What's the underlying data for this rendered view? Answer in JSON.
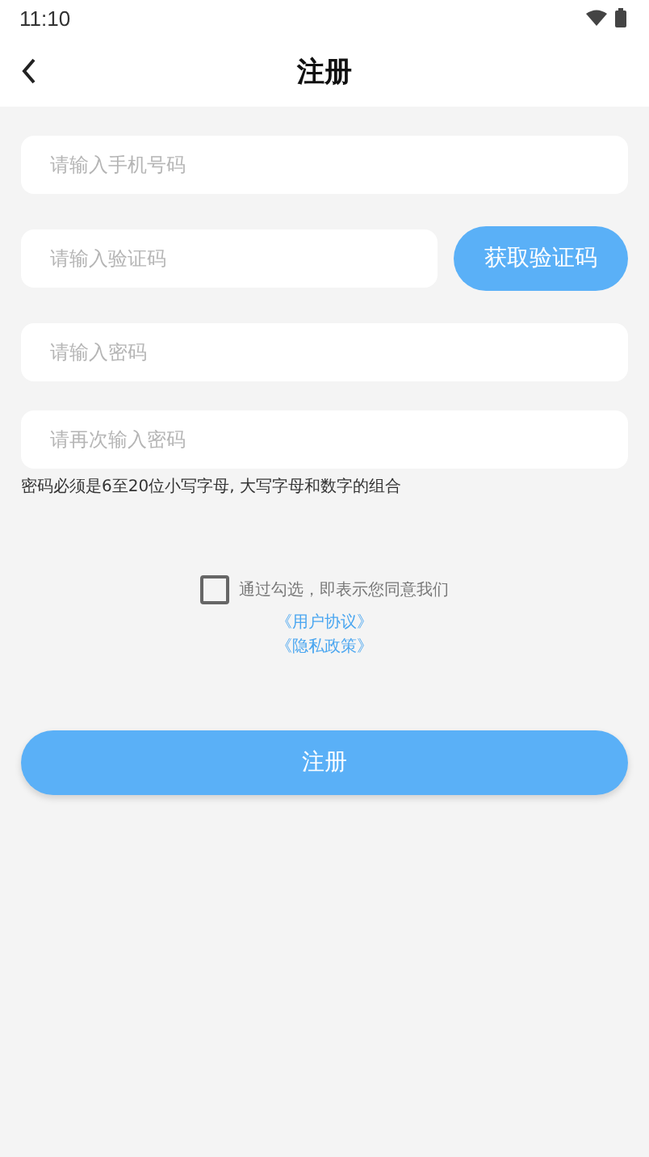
{
  "status_bar": {
    "time": "11:10"
  },
  "header": {
    "title": "注册"
  },
  "fields": [
    {
      "placeholder": "请输入手机号码"
    },
    {
      "placeholder": "请输入验证码",
      "button": "获取验证码"
    },
    {
      "placeholder": "请输入密码"
    },
    {
      "placeholder": "请再次输入密码"
    }
  ],
  "hint": "密码必须是6至20位小写字母, 大写字母和数字的组合",
  "agreement": {
    "checked": false,
    "text": "通过勾选，即表示您同意我们",
    "links": [
      "《用户协议》",
      "《隐私政策》"
    ]
  },
  "submit": "注册"
}
